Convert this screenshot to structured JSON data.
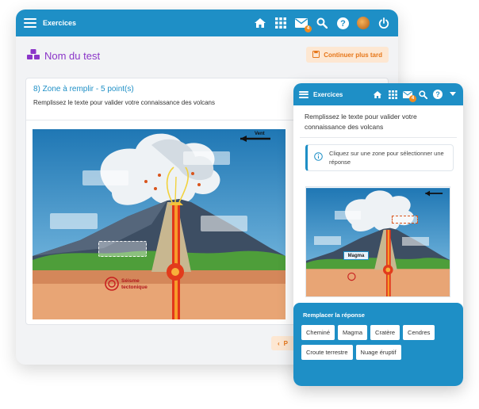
{
  "app": {
    "title": "Exercices",
    "notification_count": "4"
  },
  "desktop": {
    "test_title": "Nom du test",
    "continue_later": "Continuer plus tard",
    "question": {
      "number_label": "8) Zone à remplir - 5 point(s)",
      "instruction": "Remplissez le texte pour valider votre connaissance des volcans"
    },
    "prev_label": "P"
  },
  "diagram": {
    "wind_label": "Vent",
    "seisme_line1": "Séisme",
    "seisme_line2": "tectonique"
  },
  "mobile": {
    "instruction": "Remplissez le texte pour valider votre connaissance des volcans",
    "info_text": "Cliquez sur une zone pour sélectionner une réponse",
    "filled_answer": "Magma",
    "sheet_title": "Remplacer la réponse",
    "answers": [
      "Cheminé",
      "Magma",
      "Cratère",
      "Cendres",
      "Croute terrestre",
      "Nuage éruptif"
    ]
  },
  "colors": {
    "primary": "#1e8fc6",
    "accent": "#f08a1f",
    "title_purple": "#8b35c8"
  }
}
